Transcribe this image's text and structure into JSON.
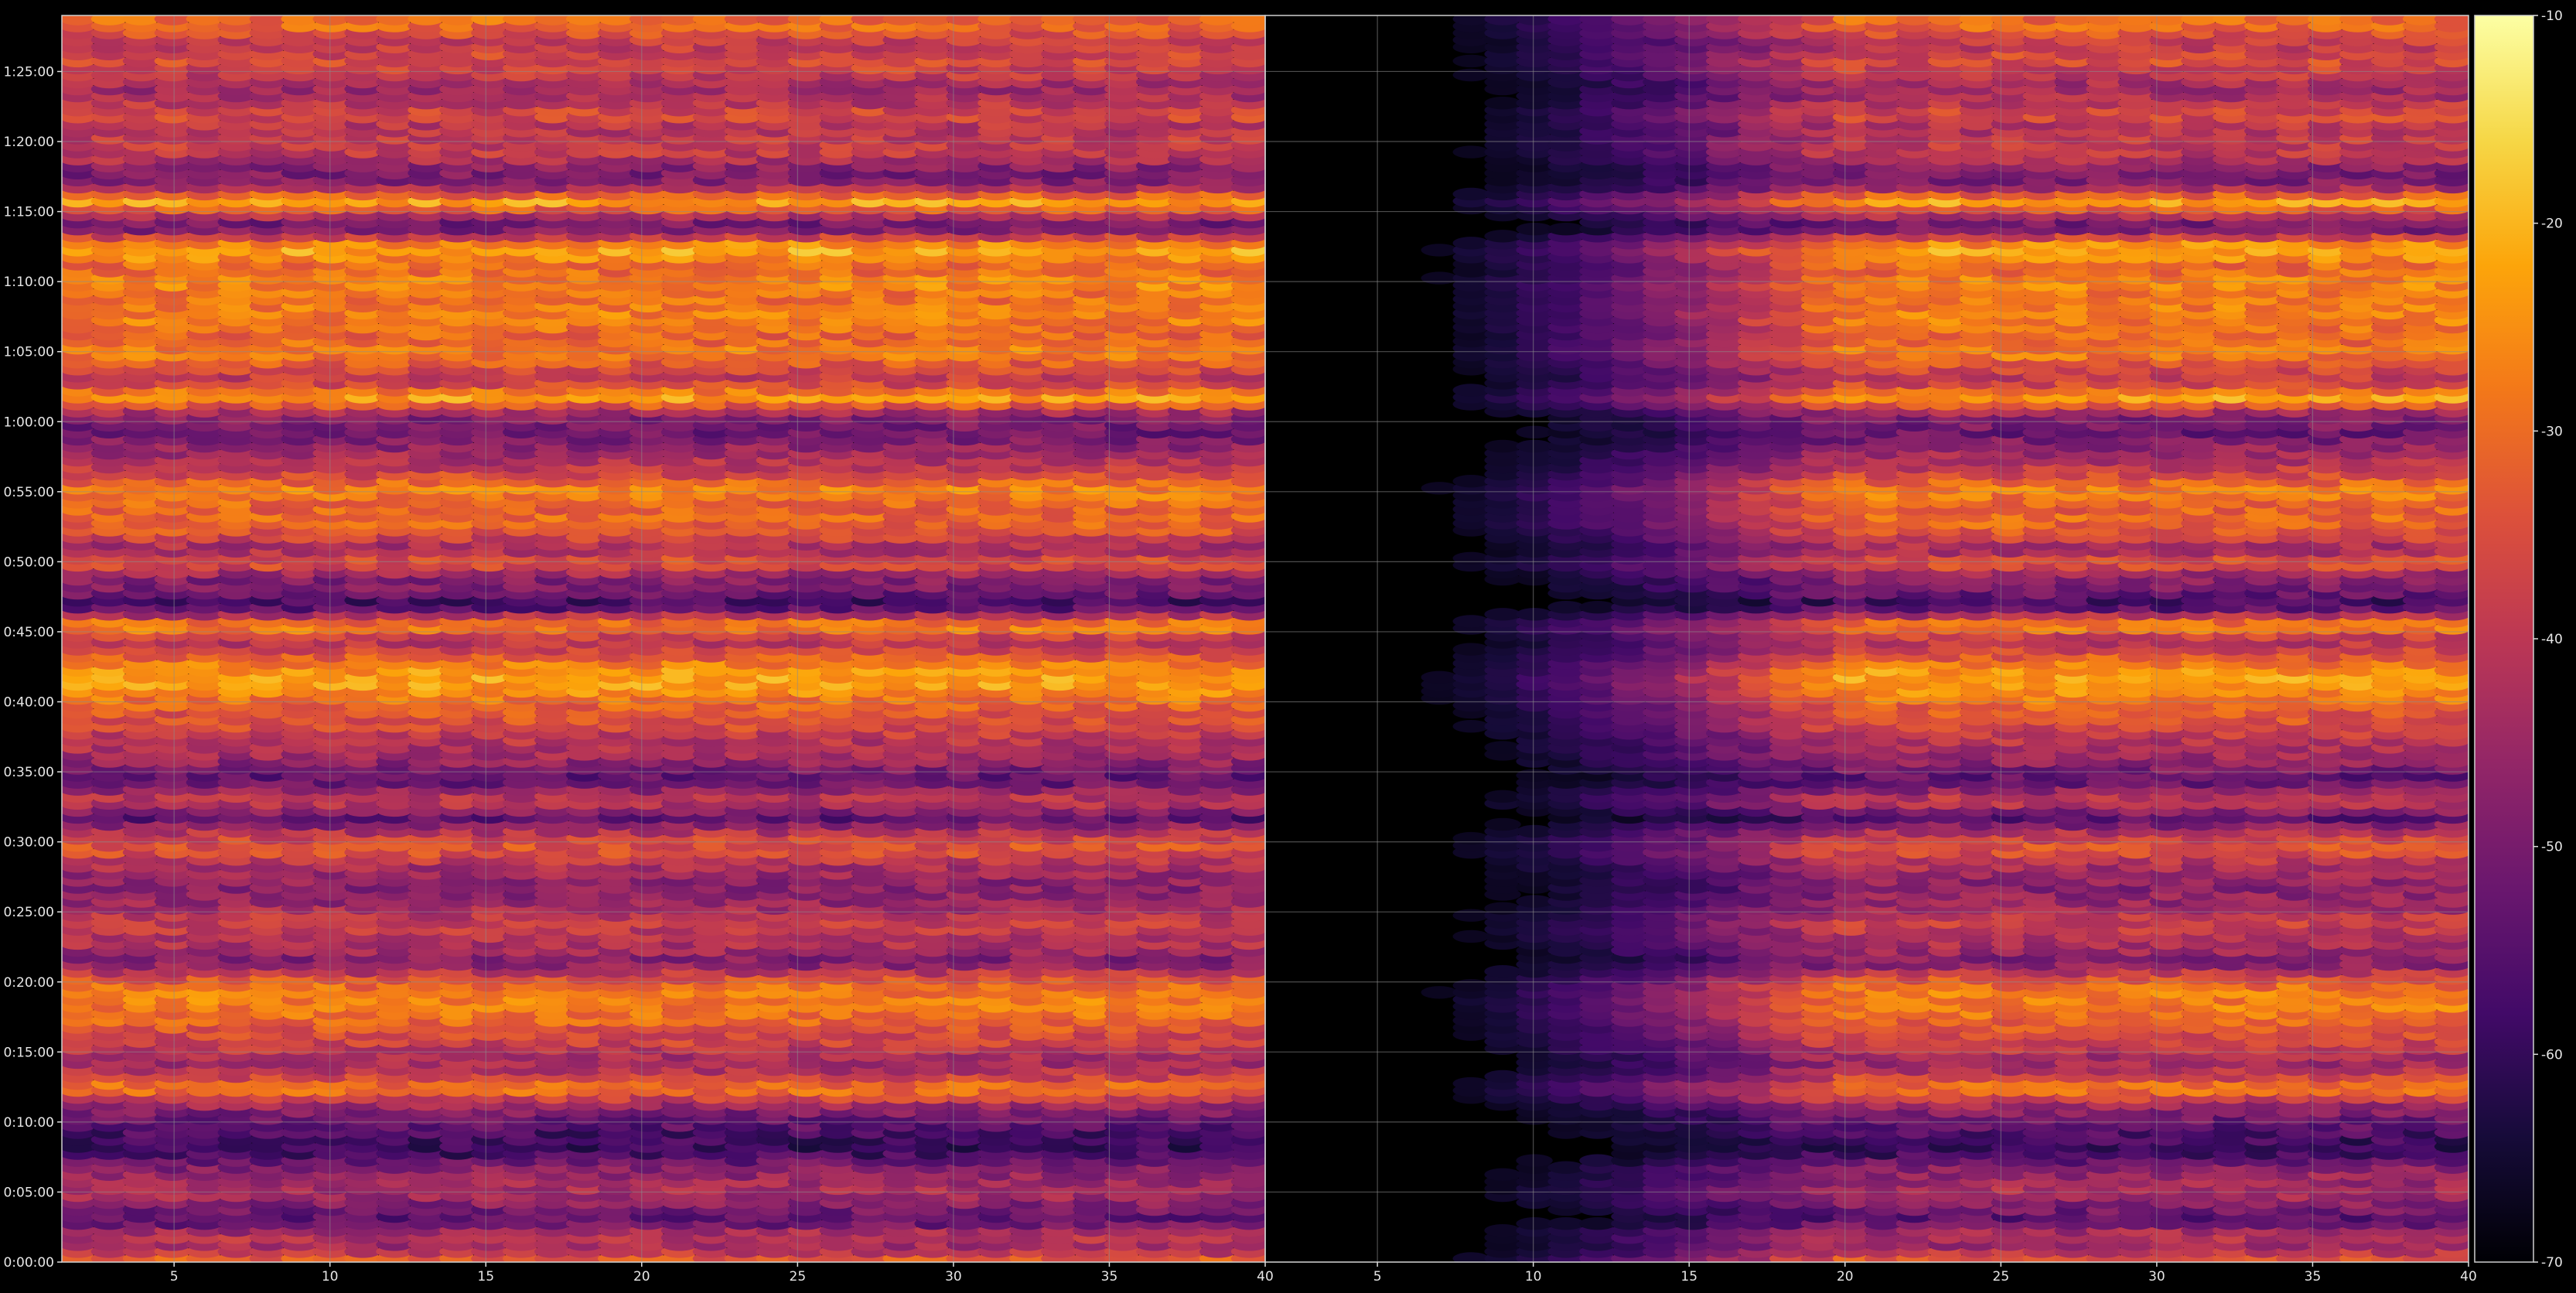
{
  "chart_data": {
    "type": "heatmap",
    "title": "",
    "xlabel": "",
    "ylabel": "",
    "panels": [
      {
        "name": "",
        "x_ticks": [
          "5",
          "10",
          "15",
          "20",
          "25",
          "30",
          "35",
          "40"
        ],
        "x_tick_values": [
          5,
          10,
          15,
          20,
          25,
          30,
          35,
          40
        ],
        "xlim": [
          1.4,
          40
        ]
      },
      {
        "name": "",
        "x_ticks": [
          "5",
          "10",
          "15",
          "20",
          "25",
          "30",
          "35",
          "40"
        ],
        "x_tick_values": [
          5,
          10,
          15,
          20,
          25,
          30,
          35,
          40
        ],
        "xlim": [
          1.4,
          40
        ],
        "fade_in_band_until": 20
      }
    ],
    "y_ticks": [
      "0:00:00",
      "0:05:00",
      "0:10:00",
      "0:15:00",
      "0:20:00",
      "0:25:00",
      "0:30:00",
      "0:35:00",
      "0:40:00",
      "0:45:00",
      "0:50:00",
      "0:55:00",
      "1:00:00",
      "1:05:00",
      "1:10:00",
      "1:15:00",
      "1:20:00",
      "1:25:00"
    ],
    "y_tick_minutes": [
      0,
      5,
      10,
      15,
      20,
      25,
      30,
      35,
      40,
      45,
      50,
      55,
      60,
      65,
      70,
      75,
      80,
      85
    ],
    "ylim_minutes": [
      0,
      89
    ],
    "band_profile": [
      {
        "minute": 0.5,
        "level": -33
      },
      {
        "minute": 1,
        "level": -45
      },
      {
        "minute": 2,
        "level": -40
      },
      {
        "minute": 3,
        "level": -55
      },
      {
        "minute": 4,
        "level": -50
      },
      {
        "minute": 5,
        "level": -42
      },
      {
        "minute": 6,
        "level": -45
      },
      {
        "minute": 6.8,
        "level": -48
      },
      {
        "minute": 8,
        "level": -60
      },
      {
        "minute": 9,
        "level": -58
      },
      {
        "minute": 11,
        "level": -48
      },
      {
        "minute": 12.5,
        "level": -27
      },
      {
        "minute": 13.5,
        "level": -40
      },
      {
        "minute": 14.5,
        "level": -45
      },
      {
        "minute": 15.5,
        "level": -38
      },
      {
        "minute": 16.5,
        "level": -35
      },
      {
        "minute": 17.5,
        "level": -30
      },
      {
        "minute": 18.5,
        "level": -27
      },
      {
        "minute": 19.5,
        "level": -28
      },
      {
        "minute": 20.3,
        "level": -34
      },
      {
        "minute": 21.5,
        "level": -50
      },
      {
        "minute": 22.5,
        "level": -43
      },
      {
        "minute": 23.5,
        "level": -40
      },
      {
        "minute": 24.5,
        "level": -38
      },
      {
        "minute": 25.5,
        "level": -45
      },
      {
        "minute": 27,
        "level": -48
      },
      {
        "minute": 28.5,
        "level": -42
      },
      {
        "minute": 29.5,
        "level": -33
      },
      {
        "minute": 30.5,
        "level": -38
      },
      {
        "minute": 31.8,
        "level": -55
      },
      {
        "minute": 33,
        "level": -38
      },
      {
        "minute": 34.5,
        "level": -55
      },
      {
        "minute": 36,
        "level": -45
      },
      {
        "minute": 37.5,
        "level": -40
      },
      {
        "minute": 38.5,
        "level": -35
      },
      {
        "minute": 39.5,
        "level": -33
      },
      {
        "minute": 40.5,
        "level": -27
      },
      {
        "minute": 41.5,
        "level": -22
      },
      {
        "minute": 42.5,
        "level": -25
      },
      {
        "minute": 43.5,
        "level": -35
      },
      {
        "minute": 44.5,
        "level": -42
      },
      {
        "minute": 45.5,
        "level": -24
      },
      {
        "minute": 47,
        "level": -60
      },
      {
        "minute": 48,
        "level": -50
      },
      {
        "minute": 49,
        "level": -48
      },
      {
        "minute": 50,
        "level": -32
      },
      {
        "minute": 51,
        "level": -45
      },
      {
        "minute": 52,
        "level": -35
      },
      {
        "minute": 53,
        "level": -30
      },
      {
        "minute": 54,
        "level": -32
      },
      {
        "minute": 55.2,
        "level": -26
      },
      {
        "minute": 56.5,
        "level": -38
      },
      {
        "minute": 58,
        "level": -45
      },
      {
        "minute": 59.2,
        "level": -52
      },
      {
        "minute": 60.5,
        "level": -48
      },
      {
        "minute": 61.8,
        "level": -22
      },
      {
        "minute": 63,
        "level": -40
      },
      {
        "minute": 64,
        "level": -35
      },
      {
        "minute": 65,
        "level": -26
      },
      {
        "minute": 66,
        "level": -32
      },
      {
        "minute": 67,
        "level": -28
      },
      {
        "minute": 68,
        "level": -27
      },
      {
        "minute": 69,
        "level": -30
      },
      {
        "minute": 70,
        "level": -25
      },
      {
        "minute": 71,
        "level": -32
      },
      {
        "minute": 72.5,
        "level": -20
      },
      {
        "minute": 74,
        "level": -55
      },
      {
        "minute": 75.8,
        "level": -22
      },
      {
        "minute": 77,
        "level": -48
      },
      {
        "minute": 78,
        "level": -50
      },
      {
        "minute": 79,
        "level": -40
      },
      {
        "minute": 80,
        "level": -38
      },
      {
        "minute": 81,
        "level": -42
      },
      {
        "minute": 82,
        "level": -35
      },
      {
        "minute": 83,
        "level": -42
      },
      {
        "minute": 84,
        "level": -45
      },
      {
        "minute": 85,
        "level": -38
      },
      {
        "minute": 86,
        "level": -35
      },
      {
        "minute": 87,
        "level": -40
      },
      {
        "minute": 88.3,
        "level": -30
      }
    ],
    "colorbar": {
      "colormap": "inferno",
      "range": [
        -70,
        -10
      ],
      "ticks": [
        "-10",
        "-20",
        "-30",
        "-40",
        "-50",
        "-60",
        "-70"
      ],
      "tick_values": [
        -10,
        -20,
        -30,
        -40,
        -50,
        -60,
        -70
      ]
    },
    "background": "#000000",
    "grid": true,
    "grid_color": "#8c8c8c"
  }
}
